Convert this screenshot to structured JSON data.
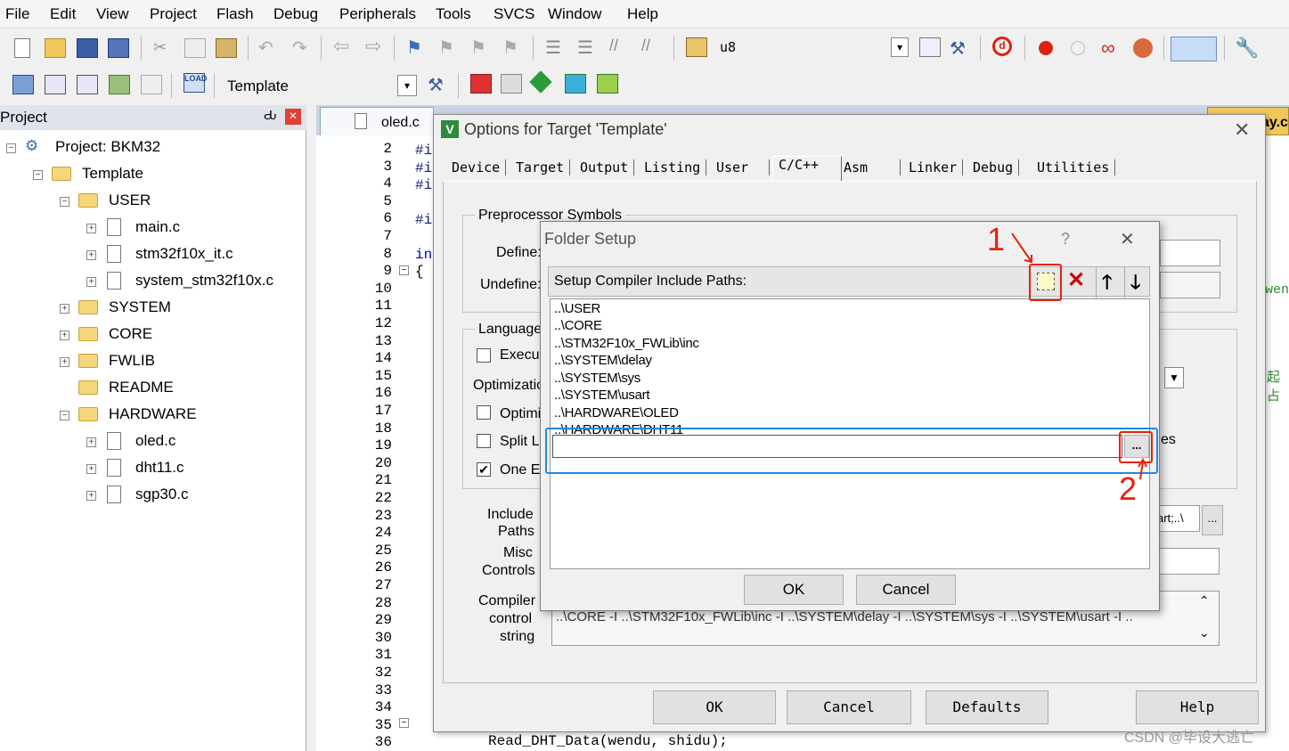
{
  "menu": [
    "File",
    "Edit",
    "View",
    "Project",
    "Flash",
    "Debug",
    "Peripherals",
    "Tools",
    "SVCS",
    "Window",
    "Help"
  ],
  "toolbar1": {
    "target_combo": "u8"
  },
  "toolbar2": {
    "target_name": "Template"
  },
  "project_panel": {
    "title": "Project",
    "pin": "Ԃ",
    "close": "×",
    "root": "Project: BKM32",
    "target": "Template",
    "groups": [
      "USER",
      "SYSTEM",
      "CORE",
      "FWLIB",
      "README",
      "HARDWARE"
    ],
    "user_files": [
      "main.c",
      "stm32f10x_it.c",
      "system_stm32f10x.c"
    ],
    "hardware_files": [
      "oled.c",
      "dht11.c",
      "sgp30.c"
    ]
  },
  "editor": {
    "tab": "oled.c",
    "right_tab": "ay.c",
    "line_numbers": [
      "2",
      "3",
      "4",
      "5",
      "6",
      "7",
      "8",
      "9",
      "10",
      "11",
      "12",
      "13",
      "14",
      "15",
      "16",
      "17",
      "18",
      "19",
      "20",
      "21",
      "22",
      "23",
      "24",
      "25",
      "26",
      "27",
      "28",
      "29",
      "30",
      "31",
      "32",
      "33",
      "34",
      "35",
      "36"
    ],
    "code_snips": [
      "#i",
      "#i",
      "#i",
      "#i",
      "in",
      "{"
    ],
    "last_line": "Read_DHT_Data(wendu, shidu);",
    "side_text1": "wen",
    "side_text2": "起占"
  },
  "options_dialog": {
    "title": "Options for Target 'Template'",
    "close": "✕",
    "tabs": [
      "Device",
      "Target",
      "Output",
      "Listing",
      "User",
      "C/C++",
      "Asm",
      "Linker",
      "Debug",
      "Utilities"
    ],
    "preproc_group": "Preprocessor Symbols",
    "define_label": "Define:",
    "undefine_label": "Undefine:",
    "language_group": "Language",
    "exec_label": "Execu",
    "optimization_label": "Optimizatio",
    "optimi_label": "Optimi",
    "split_label": "Split L",
    "one_label": "One E",
    "es_text": "es",
    "include_label": "Include",
    "paths_label": "Paths",
    "misc_label": "Misc",
    "controls_label": "Controls",
    "compiler_label": "Compiler",
    "control_label": "control",
    "string_label": "string",
    "include_value": "art;..\\",
    "compiler_string": "..\\CORE -I ..\\STM32F10x_FWLib\\inc -I ..\\SYSTEM\\delay -I ..\\SYSTEM\\sys -I ..\\SYSTEM\\usart -I ..",
    "ok": "OK",
    "cancel": "Cancel",
    "defaults": "Defaults",
    "help": "Help",
    "browse": "..."
  },
  "folder_dialog": {
    "title": "Folder Setup",
    "help": "?",
    "close": "✕",
    "header": "Setup Compiler Include Paths:",
    "paths": [
      "..\\USER",
      "..\\CORE",
      "..\\STM32F10x_FWLib\\inc",
      "..\\SYSTEM\\delay",
      "..\\SYSTEM\\sys",
      "..\\SYSTEM\\usart",
      "..\\HARDWARE\\OLED",
      "..\\HARDWARE\\DHT11"
    ],
    "edit_value": "",
    "browse": "...",
    "ok": "OK",
    "cancel": "Cancel"
  },
  "annotations": {
    "n1": "1",
    "n2": "2"
  },
  "watermark": "CSDN @毕设大逃亡",
  "colors": {
    "annotation_red": "#e8210c",
    "highlight_blue": "#1e88e5",
    "tab_active": "#f0f0f0"
  }
}
